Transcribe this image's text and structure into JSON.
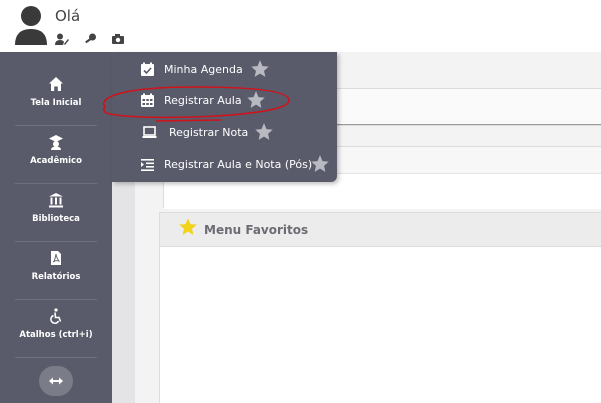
{
  "header": {
    "greeting": "Olá",
    "icons": [
      "user-edit-icon",
      "key-icon",
      "camera-icon"
    ]
  },
  "sidebar": {
    "items": [
      {
        "label": "Tela Inicial",
        "icon": "home-icon"
      },
      {
        "label": "Acadêmico",
        "icon": "graduation-cap-icon"
      },
      {
        "label": "Biblioteca",
        "icon": "library-icon"
      },
      {
        "label": "Relatórios",
        "icon": "pdf-file-icon"
      },
      {
        "label": "Atalhos (ctrl+i)",
        "icon": "accessibility-icon"
      }
    ],
    "expand_icon": "expand-arrows-icon"
  },
  "dropdown": {
    "items": [
      {
        "label": "Minha Agenda",
        "icon": "calendar-check-icon"
      },
      {
        "label": "Registrar Aula",
        "icon": "calendar-grid-icon"
      },
      {
        "label": "Registrar Nota",
        "icon": "laptop-icon"
      },
      {
        "label": "Registrar Aula e Nota (Pós)",
        "icon": "list-indent-icon"
      }
    ]
  },
  "favorites": {
    "title": "Menu Favoritos"
  },
  "colors": {
    "sidebar_bg": "#595b6a",
    "star_grey": "#b9bac1",
    "star_yellow": "#f2d31b",
    "annotation_red": "#d0121b"
  }
}
